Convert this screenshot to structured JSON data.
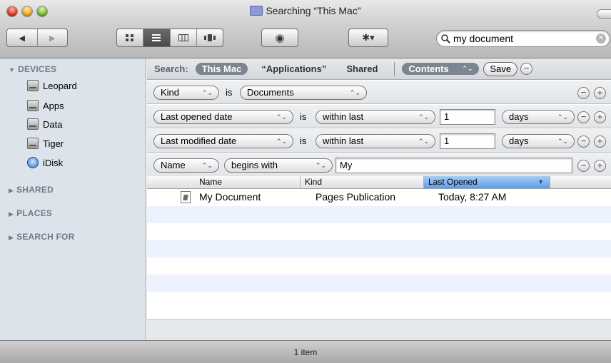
{
  "window": {
    "title": "Searching “This Mac”"
  },
  "toolbar": {
    "back_label": "◀",
    "forward_label": "▶",
    "view_icon": "◉",
    "view_icon_name": "eye-icon",
    "action_icon": "✱▾",
    "action_icon_name": "gear-icon",
    "search": {
      "value": "my document",
      "icon": "🔍"
    }
  },
  "sidebar": {
    "devices_label": "DEVICES",
    "devices": [
      "Leopard",
      "Apps",
      "Data",
      "Tiger",
      "iDisk"
    ],
    "shared_label": "SHARED",
    "places_label": "PLACES",
    "searchfor_label": "SEARCH FOR"
  },
  "scope": {
    "search_label": "Search:",
    "this_mac": "This Mac",
    "applications": "“Applications”",
    "shared": "Shared",
    "contents": "Contents",
    "save": "Save",
    "minus": "−"
  },
  "criteria": [
    {
      "attr": "Kind",
      "op": "is",
      "value": "Documents"
    },
    {
      "attr": "Last opened date",
      "op": "is",
      "qual": "within last",
      "num": "1",
      "unit": "days"
    },
    {
      "attr": "Last modified date",
      "op": "is",
      "qual": "within last",
      "num": "1",
      "unit": "days"
    },
    {
      "attr": "Name",
      "qual": "begins with",
      "text": "My"
    }
  ],
  "controls": {
    "minus": "−",
    "plus": "+",
    "updown": "⌃⌄"
  },
  "table": {
    "columns": [
      "Name",
      "Kind",
      "Last Opened"
    ],
    "sort_arrow": "▼",
    "rows": [
      {
        "name": "My Document",
        "kind": "Pages Publication",
        "last_opened": "Today, 8:27 AM"
      }
    ]
  },
  "status": {
    "text": "1 item"
  }
}
